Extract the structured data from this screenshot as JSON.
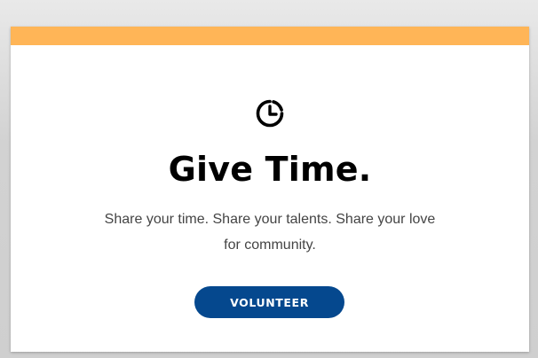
{
  "card": {
    "accent_color": "#ffb557",
    "icon": "clock-icon",
    "heading": "Give Time.",
    "body": "Share your time. Share your talents. Share your love for community.",
    "button_label": "VOLUNTEER",
    "button_color": "#05488e"
  }
}
